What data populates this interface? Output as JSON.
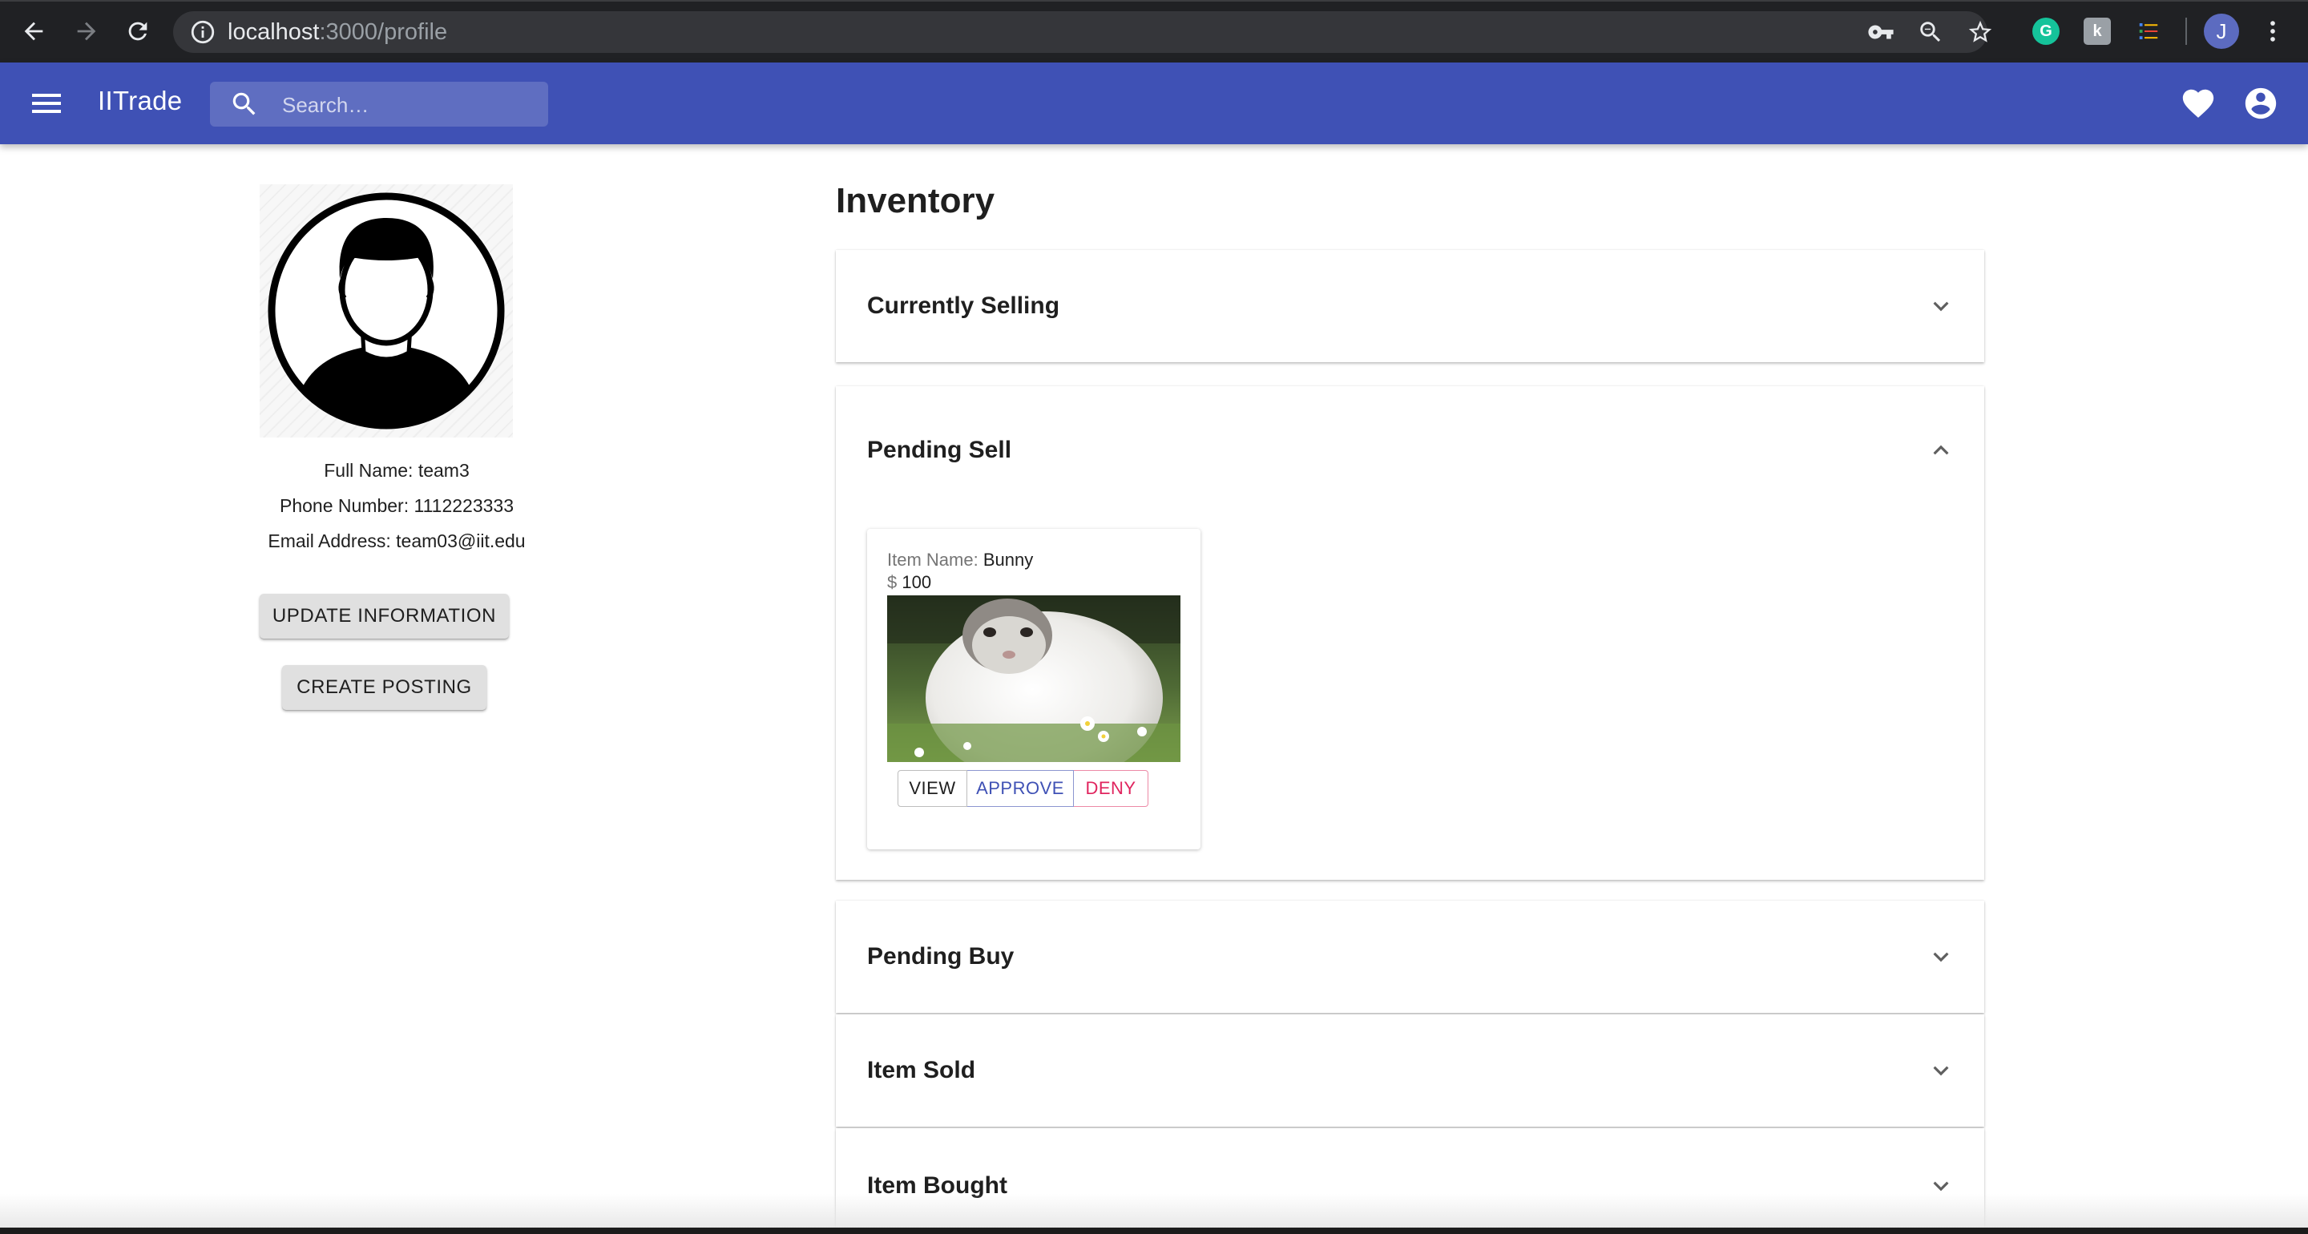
{
  "browser": {
    "url_host": "localhost",
    "url_path": ":3000/profile",
    "profile_initial": "J",
    "icons": [
      "back-arrow-icon",
      "forward-arrow-icon",
      "reload-icon",
      "info-icon",
      "key-icon",
      "zoom-icon",
      "star-icon",
      "grammarly-extension-icon",
      "extension-icon",
      "list-extension-icon",
      "more-vert-icon"
    ]
  },
  "appbar": {
    "title": "IITrade",
    "search_placeholder": "Search…",
    "color": "#3f51b5"
  },
  "profile": {
    "full_name_line": "Full Name: team3",
    "phone_line": "Phone Number: 1112223333",
    "email_line": "Email Address: team03@iit.edu",
    "update_button": "UPDATE INFORMATION",
    "create_button": "CREATE POSTING"
  },
  "inventory": {
    "title": "Inventory",
    "panels": [
      {
        "label": "Currently Selling",
        "expanded": false
      },
      {
        "label": "Pending Sell",
        "expanded": true
      },
      {
        "label": "Pending Buy",
        "expanded": false
      },
      {
        "label": "Item Sold",
        "expanded": false
      },
      {
        "label": "Item Bought",
        "expanded": false
      }
    ],
    "pending_item": {
      "name_label": "Item Name:",
      "name": "Bunny",
      "currency": "$",
      "price": "100",
      "view": "VIEW",
      "approve": "APPROVE",
      "deny": "DENY"
    }
  },
  "colors": {
    "primary": "#3f51b5",
    "deny": "#e0245e"
  }
}
